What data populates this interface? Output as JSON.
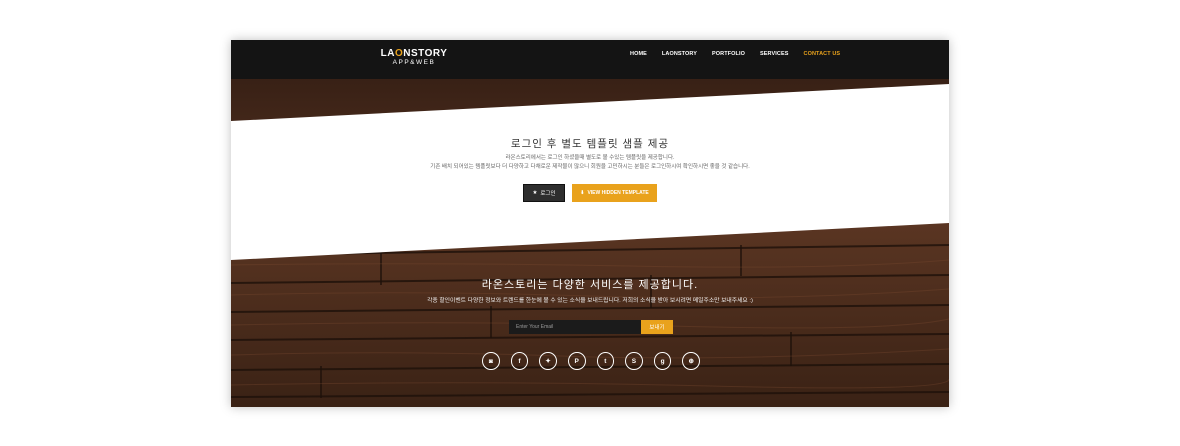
{
  "brand": {
    "logo_main_a": "LA",
    "logo_main_b": "O",
    "logo_main_c": "NSTORY",
    "logo_sub": "APP&WEB"
  },
  "nav": {
    "items": [
      {
        "label": "HOME"
      },
      {
        "label": "LAONSTORY"
      },
      {
        "label": "PORTFOLIO"
      },
      {
        "label": "SERVICES"
      },
      {
        "label": "CONTACT US",
        "active": true
      }
    ]
  },
  "hero": {
    "title": "로그인 후 별도 템플릿 샘플 제공",
    "desc_line1": "라온스토리에서는 로그인 하셨을때 별도로 볼 수있는 템플릿을 제공합니다.",
    "desc_line2": "기존 배치 되어있는 템플릿보다 더 다양하고 다채로운 제작물이 많으니 회원을 고민하시는 분들은 로그인하시여 확인하시면 좋을 것 같습니다.",
    "login_label": "로그인",
    "hidden_label": "VIEW HIDDEN TEMPLATE"
  },
  "newsletter": {
    "title": "라온스토리는 다양한 서비스를 제공합니다.",
    "desc": "각종 할인이벤트 다양한 정보와 트렌드를 한눈에 볼 수 있는 소식을 보내드립니다. 저희의 소식을 받아 보시려면 메일주소만 보내주세요 :)",
    "email_placeholder": "Enter Your Email",
    "send_label": "보내기"
  },
  "social_icons": [
    "instagram-icon",
    "facebook-icon",
    "twitter-icon",
    "pinterest-icon",
    "tumblr-icon",
    "stumbleupon-icon",
    "google-plus-icon",
    "dribbble-icon"
  ],
  "colors": {
    "accent": "#e9a21c",
    "nav_bg": "#141414",
    "wood": "#4a2c1c"
  }
}
